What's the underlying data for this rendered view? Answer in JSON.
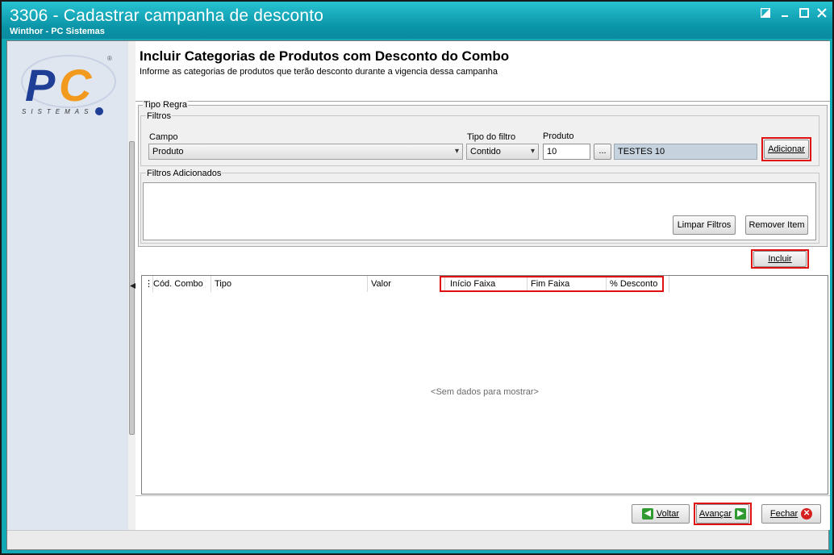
{
  "window": {
    "title": "3306 - Cadastrar campanha de desconto",
    "subtitle": "Winthor - PC Sistemas"
  },
  "logo": {
    "text": "PC",
    "brand_sub": "SISTEMAS",
    "registered": "®"
  },
  "header": {
    "title": "Incluir Categorias de Produtos com Desconto do Combo",
    "description": "Informe as categorias de produtos que terão desconto durante a vigencia dessa campanha"
  },
  "tipo_regra": {
    "legend": "Tipo Regra",
    "filtros": {
      "legend": "Filtros",
      "campo_label": "Campo",
      "campo_value": "Produto",
      "tipo_filtro_label": "Tipo do filtro",
      "tipo_filtro_value": "Contido",
      "produto_label": "Produto",
      "produto_value": "10",
      "ellipsis_label": "...",
      "produto_desc": "TESTES 10",
      "adicionar_label": "Adicionar"
    },
    "filtros_adicionados": {
      "legend": "Filtros Adicionados",
      "limpar_label": "Limpar Filtros",
      "remover_label": "Remover Item"
    }
  },
  "incluir_label": "Incluir",
  "grid": {
    "columns": [
      "Cód. Combo",
      "Tipo",
      "Valor",
      "Início Faixa",
      "Fim Faixa",
      "% Desconto"
    ],
    "empty_message": "<Sem dados para mostrar>"
  },
  "footer": {
    "voltar_label": "Voltar",
    "avancar_label": "Avançar",
    "fechar_label": "Fechar"
  },
  "colors": {
    "titlebar": "#0a93a6",
    "highlight": "#e01010",
    "logo_blue": "#1f3f96",
    "logo_orange": "#f29a1d"
  }
}
